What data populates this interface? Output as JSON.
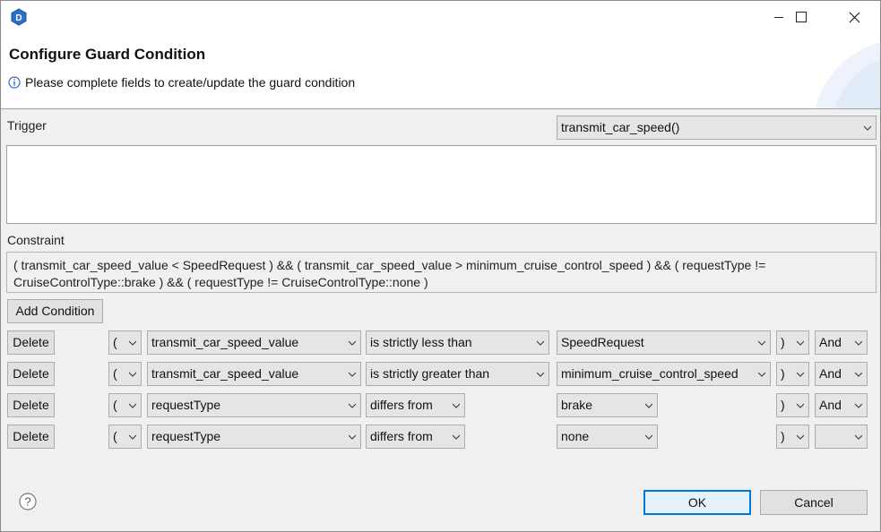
{
  "window": {
    "title": "",
    "app_icon_letter": "D",
    "minimize_glyph": "—",
    "maximize_glyph": "☐",
    "close_glyph": "✕"
  },
  "header": {
    "title": "Configure Guard Condition",
    "message": "Please complete fields to create/update the guard condition",
    "info_icon": "info-icon"
  },
  "trigger": {
    "label": "Trigger",
    "selected": "transmit_car_speed()",
    "text": ""
  },
  "constraint": {
    "label": "Constraint",
    "text": "( transmit_car_speed_value < SpeedRequest ) && ( transmit_car_speed_value > minimum_cruise_control_speed ) && ( requestType != CruiseControlType::brake ) && ( requestType != CruiseControlType::none )"
  },
  "add_condition_label": "Add Condition",
  "conditions": [
    {
      "delete_label": "Delete",
      "open": "(",
      "variable": "transmit_car_speed_value",
      "operator": "is strictly less than",
      "value": "SpeedRequest",
      "close": ")",
      "logic": "And"
    },
    {
      "delete_label": "Delete",
      "open": "(",
      "variable": "transmit_car_speed_value",
      "operator": "is strictly greater than",
      "value": "minimum_cruise_control_speed",
      "close": ")",
      "logic": "And"
    },
    {
      "delete_label": "Delete",
      "open": "(",
      "variable": "requestType",
      "operator": "differs from",
      "value": "brake",
      "close": ")",
      "logic": "And"
    },
    {
      "delete_label": "Delete",
      "open": "(",
      "variable": "requestType",
      "operator": "differs from",
      "value": "none",
      "close": ")",
      "logic": ""
    }
  ],
  "footer": {
    "ok_label": "OK",
    "cancel_label": "Cancel",
    "help_icon": "help-icon"
  },
  "colors": {
    "accent": "#0078d7",
    "dialog_bg": "#f0f0f0",
    "combo_bg": "#e5e5e5"
  }
}
